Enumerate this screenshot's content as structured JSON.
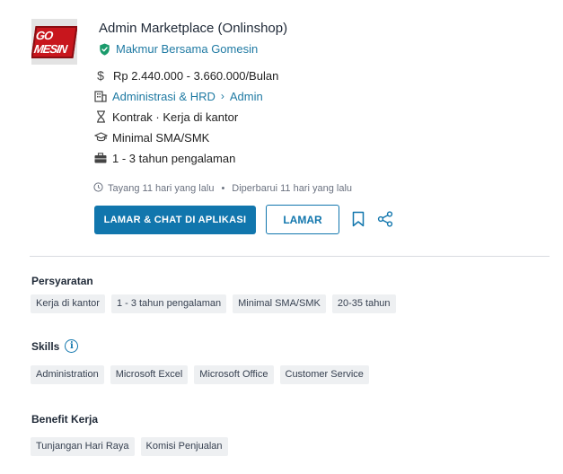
{
  "job": {
    "title": "Admin Marketplace (Onlinshop)",
    "company": "Makmur Bersama Gomesin",
    "logo_text": "GO MESIN",
    "salary": "Rp  2.440.000 - 3.660.000/Bulan",
    "category": "Administrasi & HRD",
    "subcategory": "Admin",
    "type": "Kontrak · Kerja di kantor",
    "education": "Minimal SMA/SMK",
    "experience": "1 - 3 tahun pengalaman",
    "posted": "Tayang 11 hari yang lalu",
    "updated": "Diperbarui 11 hari yang lalu"
  },
  "actions": {
    "apply_chat_label": "LAMAR & CHAT DI APLIKASI",
    "apply_label": "LAMAR"
  },
  "requirements": {
    "title": "Persyaratan",
    "chips": [
      "Kerja di kantor",
      "1 - 3 tahun pengalaman",
      "Minimal SMA/SMK",
      "20-35 tahun"
    ]
  },
  "skills": {
    "title": "Skills",
    "chips": [
      "Administration",
      "Microsoft Excel",
      "Microsoft Office",
      "Customer Service"
    ]
  },
  "benefits": {
    "title": "Benefit Kerja",
    "chips": [
      "Tunjangan Hari Raya",
      "Komisi Penjualan"
    ]
  },
  "colors": {
    "primary": "#1176ad",
    "link": "#1f7aa3",
    "verified": "#1a9b6c",
    "chip_bg": "#eef0f2"
  },
  "icons": [
    "verified-shield-icon",
    "dollar-icon",
    "building-icon",
    "chevron-right-icon",
    "hourglass-icon",
    "graduation-cap-icon",
    "briefcase-icon",
    "clock-icon",
    "bookmark-icon",
    "share-icon",
    "info-icon"
  ]
}
